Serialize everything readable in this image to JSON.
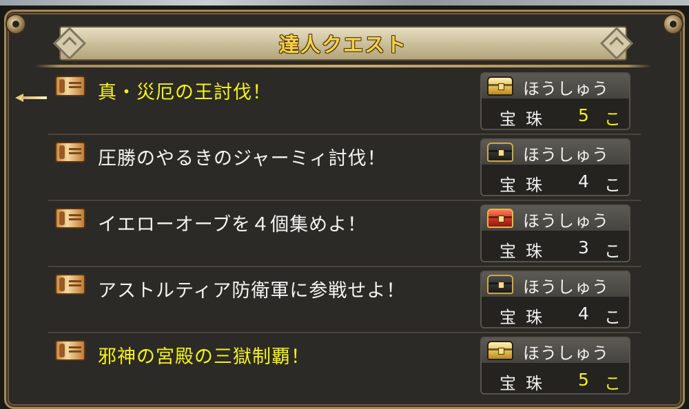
{
  "title": "達人クエスト",
  "reward_label": "ほうしゅう",
  "quests": [
    {
      "name": "真・災厄の王討伐！",
      "selected": true,
      "highlight": true,
      "reward_item": "宝珠",
      "reward_count": "5",
      "reward_unit": "こ",
      "chest": "gold-chest-icon"
    },
    {
      "name": "圧勝のやるきのジャーミィ討伐！",
      "selected": false,
      "highlight": false,
      "reward_item": "宝珠",
      "reward_count": "4",
      "reward_unit": "こ",
      "chest": "black-chest-icon"
    },
    {
      "name": "イエローオーブを４個集めよ！",
      "selected": false,
      "highlight": false,
      "reward_item": "宝珠",
      "reward_count": "3",
      "reward_unit": "こ",
      "chest": "red-chest-icon"
    },
    {
      "name": "アストルティア防衛軍に参戦せよ！",
      "selected": false,
      "highlight": false,
      "reward_item": "宝珠",
      "reward_count": "4",
      "reward_unit": "こ",
      "chest": "black-chest-icon"
    },
    {
      "name": "邪神の宮殿の三獄制覇！",
      "selected": false,
      "highlight": true,
      "reward_item": "宝珠",
      "reward_count": "5",
      "reward_unit": "こ",
      "chest": "gold-chest-icon"
    }
  ],
  "colors": {
    "highlight_text": "#f4f21a",
    "normal_text": "#f4f4f2",
    "title_text": "#f6d34a",
    "frame_gold": "#a4875a"
  }
}
